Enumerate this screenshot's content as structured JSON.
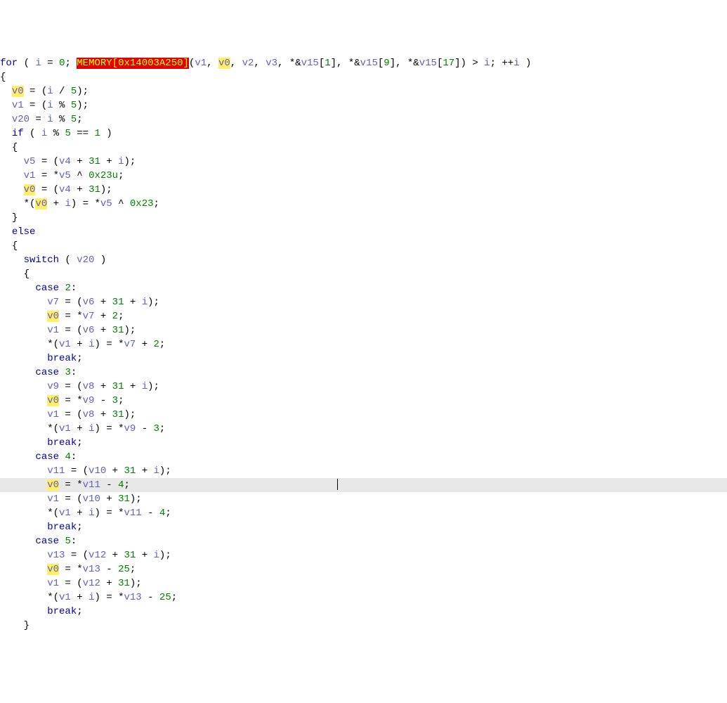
{
  "lines": [
    {
      "indent": 0,
      "cls": "",
      "segs": [
        {
          "t": "for",
          "c": "kw"
        },
        {
          "t": " ( "
        },
        {
          "t": "i",
          "c": "var"
        },
        {
          "t": " = "
        },
        {
          "t": "0",
          "c": "num"
        },
        {
          "t": "; "
        },
        {
          "t": "MEMORY[0x14003A250]",
          "c": "err"
        },
        {
          "t": "("
        },
        {
          "t": "v1",
          "c": "var"
        },
        {
          "t": ", "
        },
        {
          "t": "v0",
          "c": "var hl"
        },
        {
          "t": ", "
        },
        {
          "t": "v2",
          "c": "var"
        },
        {
          "t": ", "
        },
        {
          "t": "v3",
          "c": "var"
        },
        {
          "t": ", *&"
        },
        {
          "t": "v15",
          "c": "var"
        },
        {
          "t": "["
        },
        {
          "t": "1",
          "c": "num"
        },
        {
          "t": "], *&"
        },
        {
          "t": "v15",
          "c": "var"
        },
        {
          "t": "["
        },
        {
          "t": "9",
          "c": "num"
        },
        {
          "t": "], *&"
        },
        {
          "t": "v15",
          "c": "var"
        },
        {
          "t": "["
        },
        {
          "t": "17",
          "c": "num"
        },
        {
          "t": "]) > "
        },
        {
          "t": "i",
          "c": "var"
        },
        {
          "t": "; ++"
        },
        {
          "t": "i",
          "c": "var"
        },
        {
          "t": " )"
        }
      ]
    },
    {
      "indent": 0,
      "cls": "",
      "segs": [
        {
          "t": "{"
        }
      ]
    },
    {
      "indent": 1,
      "cls": "",
      "segs": [
        {
          "t": "v0",
          "c": "var hl"
        },
        {
          "t": " = ("
        },
        {
          "t": "i",
          "c": "var"
        },
        {
          "t": " / "
        },
        {
          "t": "5",
          "c": "num"
        },
        {
          "t": ");"
        }
      ]
    },
    {
      "indent": 1,
      "cls": "",
      "segs": [
        {
          "t": "v1",
          "c": "var"
        },
        {
          "t": " = ("
        },
        {
          "t": "i",
          "c": "var"
        },
        {
          "t": " % "
        },
        {
          "t": "5",
          "c": "num"
        },
        {
          "t": ");"
        }
      ]
    },
    {
      "indent": 1,
      "cls": "",
      "segs": [
        {
          "t": "v20",
          "c": "var"
        },
        {
          "t": " = "
        },
        {
          "t": "i",
          "c": "var"
        },
        {
          "t": " % "
        },
        {
          "t": "5",
          "c": "num"
        },
        {
          "t": ";"
        }
      ]
    },
    {
      "indent": 1,
      "cls": "",
      "segs": [
        {
          "t": "if",
          "c": "kw"
        },
        {
          "t": " ( "
        },
        {
          "t": "i",
          "c": "var"
        },
        {
          "t": " % "
        },
        {
          "t": "5",
          "c": "num"
        },
        {
          "t": " == "
        },
        {
          "t": "1",
          "c": "num"
        },
        {
          "t": " )"
        }
      ]
    },
    {
      "indent": 1,
      "cls": "",
      "segs": [
        {
          "t": "{"
        }
      ]
    },
    {
      "indent": 2,
      "cls": "",
      "segs": [
        {
          "t": "v5",
          "c": "var"
        },
        {
          "t": " = ("
        },
        {
          "t": "v4",
          "c": "var"
        },
        {
          "t": " + "
        },
        {
          "t": "31",
          "c": "num"
        },
        {
          "t": " + "
        },
        {
          "t": "i",
          "c": "var"
        },
        {
          "t": ");"
        }
      ]
    },
    {
      "indent": 2,
      "cls": "",
      "segs": [
        {
          "t": "v1",
          "c": "var"
        },
        {
          "t": " = *"
        },
        {
          "t": "v5",
          "c": "var"
        },
        {
          "t": " ^ "
        },
        {
          "t": "0x23u",
          "c": "num"
        },
        {
          "t": ";"
        }
      ]
    },
    {
      "indent": 2,
      "cls": "",
      "segs": [
        {
          "t": "v0",
          "c": "var hl"
        },
        {
          "t": " = ("
        },
        {
          "t": "v4",
          "c": "var"
        },
        {
          "t": " + "
        },
        {
          "t": "31",
          "c": "num"
        },
        {
          "t": ");"
        }
      ]
    },
    {
      "indent": 2,
      "cls": "",
      "segs": [
        {
          "t": "*("
        },
        {
          "t": "v0",
          "c": "var hl"
        },
        {
          "t": " + "
        },
        {
          "t": "i",
          "c": "var"
        },
        {
          "t": ") = *"
        },
        {
          "t": "v5",
          "c": "var"
        },
        {
          "t": " ^ "
        },
        {
          "t": "0x23",
          "c": "num"
        },
        {
          "t": ";"
        }
      ]
    },
    {
      "indent": 1,
      "cls": "",
      "segs": [
        {
          "t": "}"
        }
      ]
    },
    {
      "indent": 1,
      "cls": "",
      "segs": [
        {
          "t": "else",
          "c": "kw"
        }
      ]
    },
    {
      "indent": 1,
      "cls": "",
      "segs": [
        {
          "t": "{"
        }
      ]
    },
    {
      "indent": 2,
      "cls": "",
      "segs": [
        {
          "t": "switch",
          "c": "kw"
        },
        {
          "t": " ( "
        },
        {
          "t": "v20",
          "c": "var"
        },
        {
          "t": " )"
        }
      ]
    },
    {
      "indent": 2,
      "cls": "",
      "segs": [
        {
          "t": "{"
        }
      ]
    },
    {
      "indent": 3,
      "cls": "",
      "segs": [
        {
          "t": "case",
          "c": "kw"
        },
        {
          "t": " "
        },
        {
          "t": "2",
          "c": "num"
        },
        {
          "t": ":"
        }
      ]
    },
    {
      "indent": 4,
      "cls": "",
      "segs": [
        {
          "t": "v7",
          "c": "var"
        },
        {
          "t": " = ("
        },
        {
          "t": "v6",
          "c": "var"
        },
        {
          "t": " + "
        },
        {
          "t": "31",
          "c": "num"
        },
        {
          "t": " + "
        },
        {
          "t": "i",
          "c": "var"
        },
        {
          "t": ");"
        }
      ]
    },
    {
      "indent": 4,
      "cls": "",
      "segs": [
        {
          "t": "v0",
          "c": "var hl"
        },
        {
          "t": " = *"
        },
        {
          "t": "v7",
          "c": "var"
        },
        {
          "t": " + "
        },
        {
          "t": "2",
          "c": "num"
        },
        {
          "t": ";"
        }
      ]
    },
    {
      "indent": 4,
      "cls": "",
      "segs": [
        {
          "t": "v1",
          "c": "var"
        },
        {
          "t": " = ("
        },
        {
          "t": "v6",
          "c": "var"
        },
        {
          "t": " + "
        },
        {
          "t": "31",
          "c": "num"
        },
        {
          "t": ");"
        }
      ]
    },
    {
      "indent": 4,
      "cls": "",
      "segs": [
        {
          "t": "*("
        },
        {
          "t": "v1",
          "c": "var"
        },
        {
          "t": " + "
        },
        {
          "t": "i",
          "c": "var"
        },
        {
          "t": ") = *"
        },
        {
          "t": "v7",
          "c": "var"
        },
        {
          "t": " + "
        },
        {
          "t": "2",
          "c": "num"
        },
        {
          "t": ";"
        }
      ]
    },
    {
      "indent": 4,
      "cls": "",
      "segs": [
        {
          "t": "break",
          "c": "kw"
        },
        {
          "t": ";"
        }
      ]
    },
    {
      "indent": 3,
      "cls": "",
      "segs": [
        {
          "t": "case",
          "c": "kw"
        },
        {
          "t": " "
        },
        {
          "t": "3",
          "c": "num"
        },
        {
          "t": ":"
        }
      ]
    },
    {
      "indent": 4,
      "cls": "",
      "segs": [
        {
          "t": "v9",
          "c": "var"
        },
        {
          "t": " = ("
        },
        {
          "t": "v8",
          "c": "var"
        },
        {
          "t": " + "
        },
        {
          "t": "31",
          "c": "num"
        },
        {
          "t": " + "
        },
        {
          "t": "i",
          "c": "var"
        },
        {
          "t": ");"
        }
      ]
    },
    {
      "indent": 4,
      "cls": "",
      "segs": [
        {
          "t": "v0",
          "c": "var hl"
        },
        {
          "t": " = *"
        },
        {
          "t": "v9",
          "c": "var"
        },
        {
          "t": " - "
        },
        {
          "t": "3",
          "c": "num"
        },
        {
          "t": ";"
        }
      ]
    },
    {
      "indent": 4,
      "cls": "",
      "segs": [
        {
          "t": "v1",
          "c": "var"
        },
        {
          "t": " = ("
        },
        {
          "t": "v8",
          "c": "var"
        },
        {
          "t": " + "
        },
        {
          "t": "31",
          "c": "num"
        },
        {
          "t": ");"
        }
      ]
    },
    {
      "indent": 4,
      "cls": "",
      "segs": [
        {
          "t": "*("
        },
        {
          "t": "v1",
          "c": "var"
        },
        {
          "t": " + "
        },
        {
          "t": "i",
          "c": "var"
        },
        {
          "t": ") = *"
        },
        {
          "t": "v9",
          "c": "var"
        },
        {
          "t": " - "
        },
        {
          "t": "3",
          "c": "num"
        },
        {
          "t": ";"
        }
      ]
    },
    {
      "indent": 4,
      "cls": "",
      "segs": [
        {
          "t": "break",
          "c": "kw"
        },
        {
          "t": ";"
        }
      ]
    },
    {
      "indent": 3,
      "cls": "",
      "segs": [
        {
          "t": "case",
          "c": "kw"
        },
        {
          "t": " "
        },
        {
          "t": "4",
          "c": "num"
        },
        {
          "t": ":"
        }
      ]
    },
    {
      "indent": 4,
      "cls": "",
      "segs": [
        {
          "t": "v11",
          "c": "var"
        },
        {
          "t": " = ("
        },
        {
          "t": "v10",
          "c": "var"
        },
        {
          "t": " + "
        },
        {
          "t": "31",
          "c": "num"
        },
        {
          "t": " + "
        },
        {
          "t": "i",
          "c": "var"
        },
        {
          "t": ");"
        }
      ]
    },
    {
      "indent": 4,
      "cls": "current",
      "caret": true,
      "caret_col": 50,
      "segs": [
        {
          "t": "v0",
          "c": "var hl"
        },
        {
          "t": " = *"
        },
        {
          "t": "v11",
          "c": "var"
        },
        {
          "t": " - "
        },
        {
          "t": "4",
          "c": "num"
        },
        {
          "t": ";"
        }
      ]
    },
    {
      "indent": 4,
      "cls": "",
      "segs": [
        {
          "t": "v1",
          "c": "var"
        },
        {
          "t": " = ("
        },
        {
          "t": "v10",
          "c": "var"
        },
        {
          "t": " + "
        },
        {
          "t": "31",
          "c": "num"
        },
        {
          "t": ");"
        }
      ]
    },
    {
      "indent": 4,
      "cls": "",
      "segs": [
        {
          "t": "*("
        },
        {
          "t": "v1",
          "c": "var"
        },
        {
          "t": " + "
        },
        {
          "t": "i",
          "c": "var"
        },
        {
          "t": ") = *"
        },
        {
          "t": "v11",
          "c": "var"
        },
        {
          "t": " - "
        },
        {
          "t": "4",
          "c": "num"
        },
        {
          "t": ";"
        }
      ]
    },
    {
      "indent": 4,
      "cls": "",
      "segs": [
        {
          "t": "break",
          "c": "kw"
        },
        {
          "t": ";"
        }
      ]
    },
    {
      "indent": 3,
      "cls": "",
      "segs": [
        {
          "t": "case",
          "c": "kw"
        },
        {
          "t": " "
        },
        {
          "t": "5",
          "c": "num"
        },
        {
          "t": ":"
        }
      ]
    },
    {
      "indent": 4,
      "cls": "",
      "segs": [
        {
          "t": "v13",
          "c": "var"
        },
        {
          "t": " = ("
        },
        {
          "t": "v12",
          "c": "var"
        },
        {
          "t": " + "
        },
        {
          "t": "31",
          "c": "num"
        },
        {
          "t": " + "
        },
        {
          "t": "i",
          "c": "var"
        },
        {
          "t": ");"
        }
      ]
    },
    {
      "indent": 4,
      "cls": "",
      "segs": [
        {
          "t": "v0",
          "c": "var hl"
        },
        {
          "t": " = *"
        },
        {
          "t": "v13",
          "c": "var"
        },
        {
          "t": " - "
        },
        {
          "t": "25",
          "c": "num"
        },
        {
          "t": ";"
        }
      ]
    },
    {
      "indent": 4,
      "cls": "",
      "segs": [
        {
          "t": "v1",
          "c": "var"
        },
        {
          "t": " = ("
        },
        {
          "t": "v12",
          "c": "var"
        },
        {
          "t": " + "
        },
        {
          "t": "31",
          "c": "num"
        },
        {
          "t": ");"
        }
      ]
    },
    {
      "indent": 4,
      "cls": "",
      "segs": [
        {
          "t": "*("
        },
        {
          "t": "v1",
          "c": "var"
        },
        {
          "t": " + "
        },
        {
          "t": "i",
          "c": "var"
        },
        {
          "t": ") = *"
        },
        {
          "t": "v13",
          "c": "var"
        },
        {
          "t": " - "
        },
        {
          "t": "25",
          "c": "num"
        },
        {
          "t": ";"
        }
      ]
    },
    {
      "indent": 4,
      "cls": "",
      "segs": [
        {
          "t": "break",
          "c": "kw"
        },
        {
          "t": ";"
        }
      ]
    },
    {
      "indent": 2,
      "cls": "",
      "segs": [
        {
          "t": "}"
        }
      ]
    }
  ],
  "indentUnit": "  ",
  "caretPad": "                                   "
}
